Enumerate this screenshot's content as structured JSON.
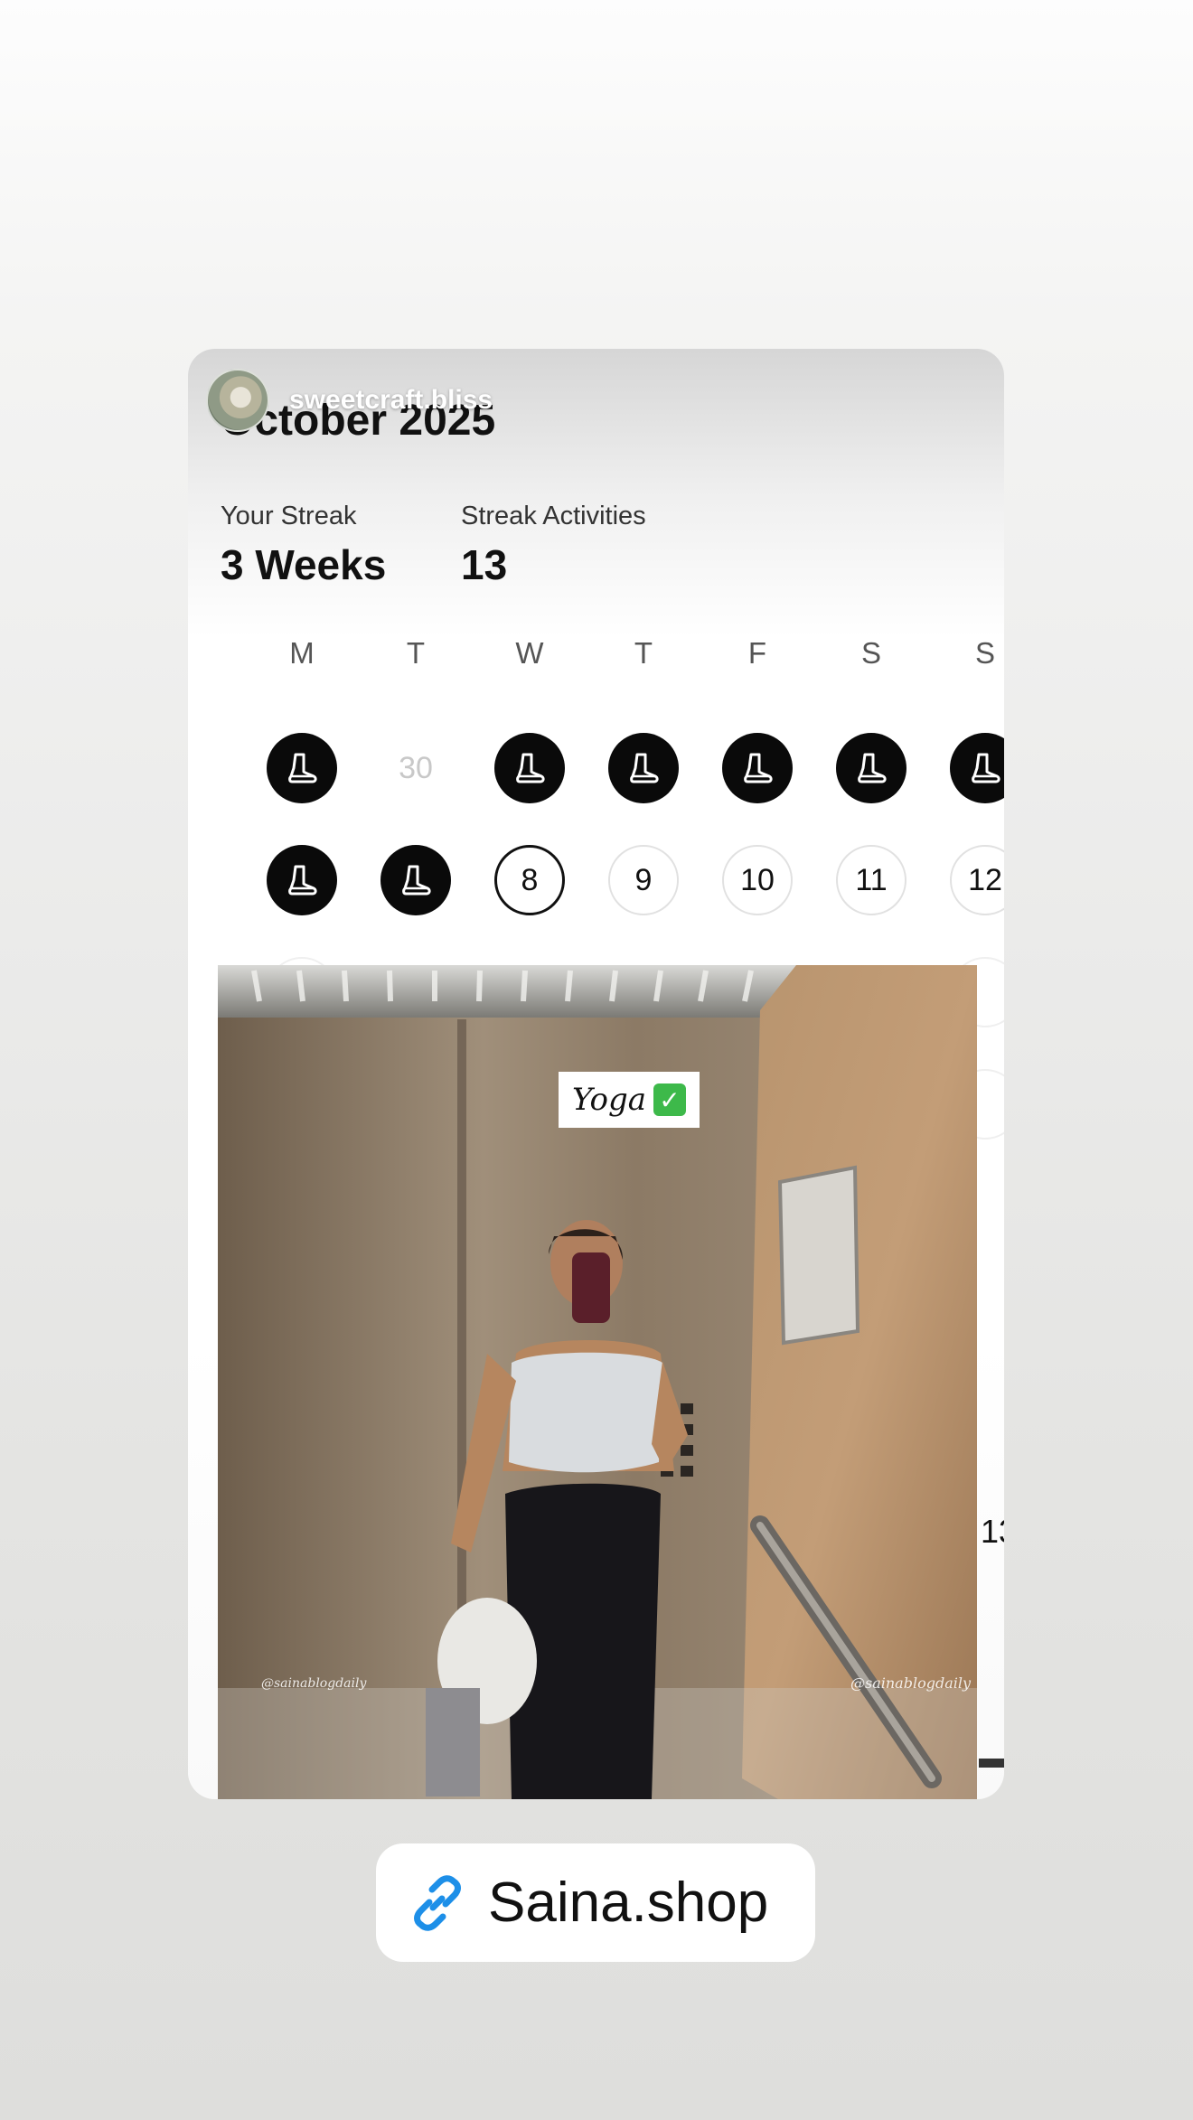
{
  "story": {
    "author": "sweetcraft.bliss"
  },
  "calendar": {
    "month_title": "October 2025",
    "streak_label": "Your Streak",
    "streak_value": "3 Weeks",
    "activities_label": "Streak Activities",
    "activities_value": "13",
    "weekdays": [
      "M",
      "T",
      "W",
      "T",
      "F",
      "S",
      "S"
    ],
    "week1": [
      "done",
      "30",
      "done",
      "done",
      "done",
      "done",
      "done"
    ],
    "week2": [
      "done",
      "done",
      "8",
      "9",
      "10",
      "11",
      "12"
    ],
    "edge_number": "13",
    "done_icon": "running-shoe-icon"
  },
  "photo": {
    "label": "Yoga",
    "label_icon": "check-mark-icon",
    "watermark_left": "@sainablogdaily",
    "watermark_right": "@sainablogdaily"
  },
  "link_sticker": {
    "icon": "link-icon",
    "text": "Saina.shop",
    "icon_color": "#1d8fe8"
  }
}
